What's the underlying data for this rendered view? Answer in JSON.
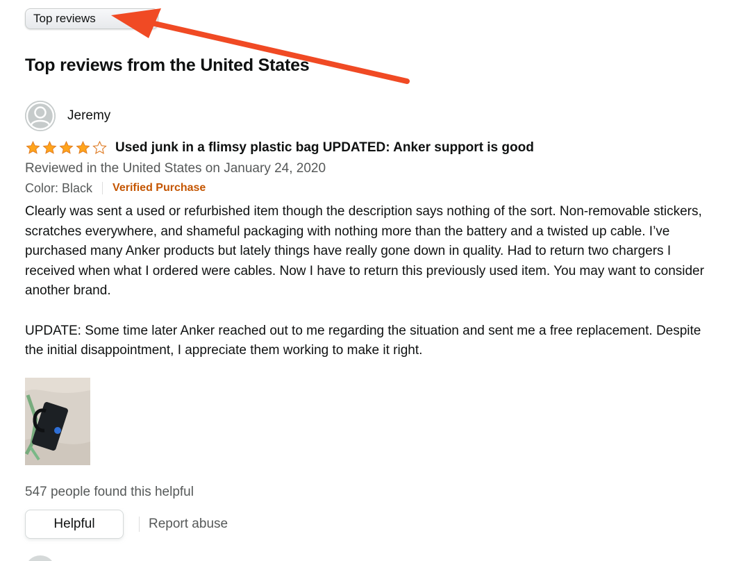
{
  "sort": {
    "selected": "Top reviews",
    "icon": "chevron-down-icon"
  },
  "section": {
    "title": "Top reviews from the United States"
  },
  "annotation": {
    "color": "#f04a24"
  },
  "review": {
    "author": "Jeremy",
    "rating": 4,
    "rating_max": 5,
    "title": "Used junk in a flimsy plastic bag UPDATED: Anker support is good",
    "date": "Reviewed in the United States on January 24, 2020",
    "color_label": "Color: Black",
    "verified": "Verified Purchase",
    "body_1": "Clearly was sent a used or refurbished item though the description says nothing of the sort. Non-removable stickers, scratches everywhere, and shameful packaging with nothing more than the battery and a twisted up cable. I’ve purchased many Anker products but lately things have really gone down in quality. Had to return two chargers I received when what I ordered were cables. Now I have to return this previously used item. You may want to consider another brand.",
    "body_2": "UPDATE: Some time later Anker reached out to me regarding the situation and sent me a free replacement. Despite the initial disappointment, I appreciate them working to make it right.",
    "helpful_count": "547 people found this helpful",
    "helpful_button": "Helpful",
    "report_link": "Report abuse"
  },
  "colors": {
    "star": "#ffa41c",
    "verified": "#c45500",
    "muted_text": "#565959"
  }
}
